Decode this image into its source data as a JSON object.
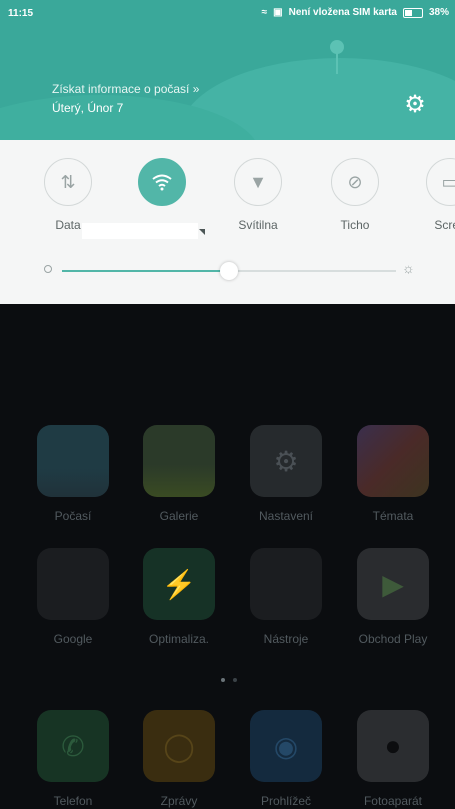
{
  "status": {
    "time": "11:15",
    "sim_text": "Není vložena SIM karta",
    "battery_percent": "38%"
  },
  "header": {
    "weather_prompt": "Získat informace o počasí »",
    "date": "Úterý, Únor 7"
  },
  "quick_toggles": [
    {
      "label": "Data",
      "icon": "data-arrows-icon",
      "active": false
    },
    {
      "label": "",
      "icon": "wifi-icon",
      "active": true
    },
    {
      "label": "Svítilna",
      "icon": "flashlight-icon",
      "active": false
    },
    {
      "label": "Ticho",
      "icon": "mute-bell-icon",
      "active": false
    },
    {
      "label": "Scree",
      "icon": "screen-icon",
      "active": false
    }
  ],
  "brightness": {
    "level_fraction": 0.5
  },
  "apps": [
    {
      "label": "Počasí"
    },
    {
      "label": "Galerie"
    },
    {
      "label": "Nastavení"
    },
    {
      "label": "Témata"
    },
    {
      "label": "Google"
    },
    {
      "label": "Optimaliza."
    },
    {
      "label": "Nástroje"
    },
    {
      "label": "Obchod Play"
    },
    {
      "label": "Telefon"
    },
    {
      "label": "Zprávy"
    },
    {
      "label": "Prohlížeč"
    },
    {
      "label": "Fotoaparát"
    }
  ],
  "page_indicator": {
    "pages": 2,
    "current": 1
  },
  "colors": {
    "accent": "#52b6a8",
    "header": "#3aa89a",
    "panel": "#f5f6f6",
    "background": "#0b0d10"
  }
}
